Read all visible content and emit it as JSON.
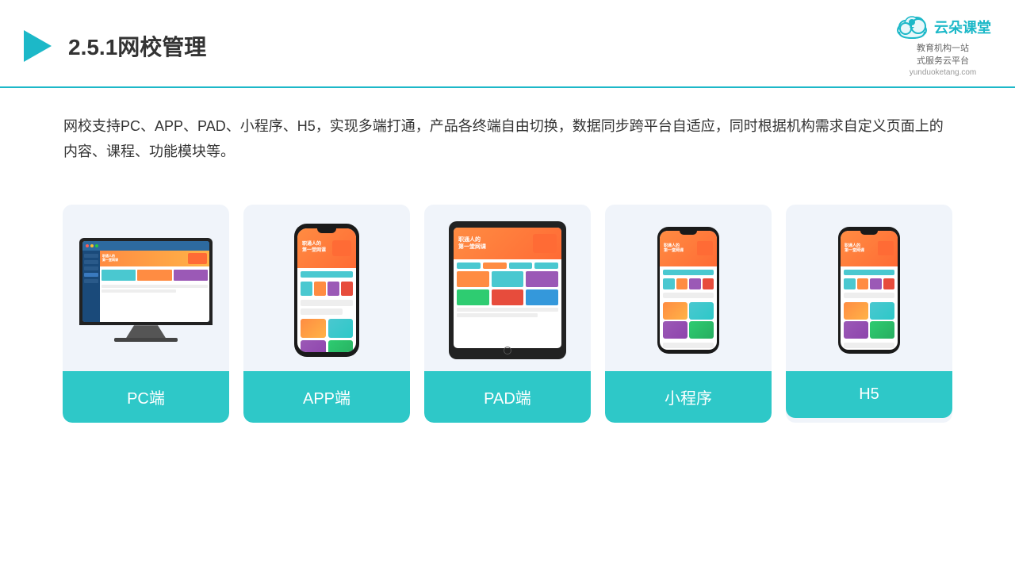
{
  "header": {
    "title": "2.5.1网校管理",
    "brand_name": "云朵课堂",
    "brand_subtitle": "教育机构一站\n式服务云平台",
    "brand_url": "yunduoketang.com"
  },
  "description": {
    "text": "网校支持PC、APP、PAD、小程序、H5，实现多端打通，产品各终端自由切换，数据同步跨平台自适应，同时根据机构需求自定义页面上的内容、课程、功能模块等。"
  },
  "cards": [
    {
      "id": "pc",
      "label": "PC端"
    },
    {
      "id": "app",
      "label": "APP端"
    },
    {
      "id": "pad",
      "label": "PAD端"
    },
    {
      "id": "miniprogram",
      "label": "小程序"
    },
    {
      "id": "h5",
      "label": "H5"
    }
  ]
}
